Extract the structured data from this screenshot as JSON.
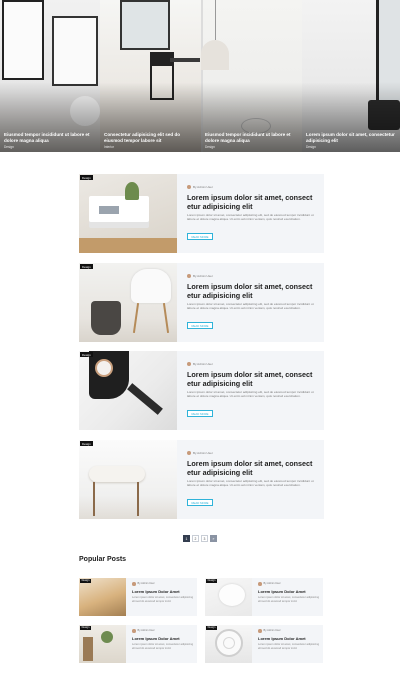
{
  "hero": {
    "slides": [
      {
        "title": "Eiusmod tempor incididunt ut labore et dolore magna aliqua",
        "meta": "Design"
      },
      {
        "title": "Consectetur adipisicing elit sed do eiusmod tempor labore sit",
        "meta": "Interior"
      },
      {
        "title": "Eiusmod tempor incididunt ut labore et dolore magna aliqua",
        "meta": "Design"
      },
      {
        "title": "Lorem ipsum dolor sit amet, consectetur adipisicing elit",
        "meta": "Design"
      }
    ]
  },
  "posts": [
    {
      "badge": "Design",
      "author": "By Admin User",
      "title": "Lorem ipsum dolor sit amet, consect etur adipisicing elit",
      "body": "Lorem ipsum dolor sit amet, consectetur adipisicing elit, sed do eiusmod tempor incididunt ut labore et dolore magna aliqua. Ut enim ad minim veniam, quis nostrud exercitation.",
      "more": "READ MORE"
    },
    {
      "badge": "Design",
      "author": "By Admin User",
      "title": "Lorem ipsum dolor sit amet, consect etur adipisicing elit",
      "body": "Lorem ipsum dolor sit amet, consectetur adipisicing elit, sed do eiusmod tempor incididunt ut labore et dolore magna aliqua. Ut enim ad minim veniam, quis nostrud exercitation.",
      "more": "READ MORE"
    },
    {
      "badge": "Design",
      "author": "By Admin User",
      "title": "Lorem ipsum dolor sit amet, consect etur adipisicing elit",
      "body": "Lorem ipsum dolor sit amet, consectetur adipisicing elit, sed do eiusmod tempor incididunt ut labore et dolore magna aliqua. Ut enim ad minim veniam, quis nostrud exercitation.",
      "more": "READ MORE"
    },
    {
      "badge": "Design",
      "author": "By Admin User",
      "title": "Lorem ipsum dolor sit amet, consect etur adipisicing elit",
      "body": "Lorem ipsum dolor sit amet, consectetur adipisicing elit, sed do eiusmod tempor incididunt ut labore et dolore magna aliqua. Ut enim ad minim veniam, quis nostrud exercitation.",
      "more": "READ MORE"
    }
  ],
  "pagination": {
    "pages": [
      "1",
      "2",
      "3"
    ],
    "next": "»"
  },
  "popular": {
    "heading": "Popular Posts",
    "items": [
      {
        "badge": "Design",
        "author": "By Admin User",
        "title": "Lorem Ipsum Dolor Amet",
        "body": "Lorem ipsum dolor sit amet, consectetur adipisicing elit sed do eiusmod tempor incid."
      },
      {
        "badge": "Design",
        "author": "By Admin User",
        "title": "Lorem Ipsum Dolor Amet",
        "body": "Lorem ipsum dolor sit amet, consectetur adipisicing elit sed do eiusmod tempor incid."
      },
      {
        "badge": "Design",
        "author": "By Admin User",
        "title": "Lorem Ipsum Dolor Amet",
        "body": "Lorem ipsum dolor sit amet, consectetur adipisicing elit sed do eiusmod tempor incid."
      },
      {
        "badge": "Design",
        "author": "By Admin User",
        "title": "Lorem Ipsum Dolor Amet",
        "body": "Lorem ipsum dolor sit amet, consectetur adipisicing elit sed do eiusmod tempor incid."
      }
    ]
  },
  "colors": {
    "accent": "#2fb3d9",
    "card_bg": "#f3f5f8",
    "pagination_active": "#333d4f"
  }
}
